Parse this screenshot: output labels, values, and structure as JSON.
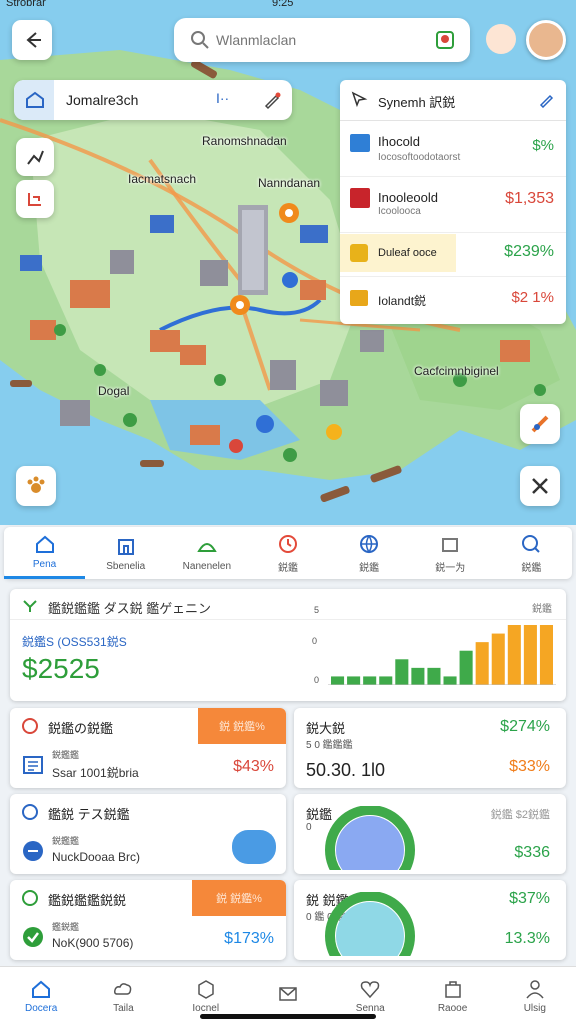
{
  "status": {
    "carrier": "Strobrar",
    "time": "9:25"
  },
  "search": {
    "placeholder": "Wlanmlaclan"
  },
  "location_card": {
    "title": "Jomalre3ch"
  },
  "map_labels": {
    "label1": "Ranomshnadan",
    "label2": "Iacmatsnach",
    "label3": "Nanndanan",
    "label4": "Cacfcimnbiginel",
    "label5": "Dogal"
  },
  "synch_panel": {
    "title": "Synemh 訳鋭",
    "items": [
      {
        "name": "Ihocold",
        "sub": "Iocosoftoodotaorst",
        "value": "$%",
        "color": "#2ba34a"
      },
      {
        "name": "Inooleoold",
        "sub": "Icoolooca",
        "value": "$1,353",
        "color": "#d9473a"
      },
      {
        "name": "Duleaf ooce",
        "sub": "",
        "value": "$239%",
        "color": "#2ba34a"
      },
      {
        "name": "Iolandt鋭",
        "sub": "",
        "value": "$2 1%",
        "color": "#d9473a"
      }
    ]
  },
  "tabs": [
    {
      "label": "Pena",
      "icon": "home-icon",
      "active": true
    },
    {
      "label": "Sbenelia",
      "icon": "building-icon",
      "active": false
    },
    {
      "label": "Nanenelen",
      "icon": "dome-icon",
      "active": false
    },
    {
      "label": "鋭鑑",
      "icon": "clock-icon",
      "active": false
    },
    {
      "label": "鋭鑑",
      "icon": "globe-icon",
      "active": false
    },
    {
      "label": "鋭一为",
      "icon": "box-icon",
      "active": false
    },
    {
      "label": "鋭鑑",
      "icon": "search-icon",
      "active": false
    }
  ],
  "stats_panel": {
    "title": "鑑鋭鑑鑑 ダス鋭 鑑ゲェニン",
    "right_label": "鋭鑑",
    "subtitle": "鋭鑑S (OSS531鋭S",
    "value": "$2525",
    "axis_top": "5",
    "axis_mid": "0",
    "axis_bottom": "0"
  },
  "chart_data": {
    "type": "bar",
    "values": [
      1,
      1,
      1,
      1,
      3,
      2,
      2,
      1,
      4,
      5,
      6,
      7,
      7,
      7
    ],
    "colors": [
      "#3faa4a",
      "#3faa4a",
      "#3faa4a",
      "#3faa4a",
      "#3faa4a",
      "#3faa4a",
      "#3faa4a",
      "#3faa4a",
      "#3faa4a",
      "#f5a623",
      "#f5a623",
      "#f5a623",
      "#f5a623",
      "#f5a623"
    ]
  },
  "left_cards": [
    {
      "title": "鋭鑑の鋭鑑",
      "badge": "鋭 鋭鑑%",
      "sub": "鋭鑑鑑",
      "detail": "Ssar 1001鋭bria",
      "value": "$43%",
      "value_color": "#d9473a",
      "icon": "list-icon"
    },
    {
      "title": "鑑鋭 テス鋭鑑",
      "badge": "",
      "sub": "鋭鑑鑑",
      "detail": "NuckDooaa Brc)",
      "value": "",
      "value_color": "#1e6fd9",
      "icon": "chat-icon"
    },
    {
      "title": "鑑鋭鑑鑑鋭鋭",
      "badge": "鋭 鋭鑑%",
      "sub": "鑑鋭鑑",
      "detail": "NoK(900 5706)",
      "value": "$173%",
      "value_color": "#1e88e5",
      "icon": "check-icon"
    }
  ],
  "right_cards": [
    {
      "title": "鋭大鋭",
      "sub": "5 0 鑑鑑鑑",
      "main": "50.30. 1l0",
      "value_top": "$274%",
      "value_bottom": "$33%",
      "top_color": "#2ba34a",
      "bottom_color": "#f07d1a"
    },
    {
      "title": "鋭鑑",
      "sub": "0",
      "main": "",
      "value_top": "鋭鑑 $2鋭鑑",
      "value_bottom": "$336",
      "top_color": "#999999",
      "bottom_color": "#2ba34a"
    },
    {
      "title": "鋭 鋭鑑",
      "sub": "0 鑑 0 鑑",
      "main": "",
      "value_top": "$37%",
      "value_bottom": "13.3%",
      "top_color": "#2ba34a",
      "bottom_color": "#2ba34a"
    }
  ],
  "nav": [
    {
      "label": "Docera",
      "icon": "home-icon",
      "active": true
    },
    {
      "label": "Taila",
      "icon": "cloud-icon",
      "active": false
    },
    {
      "label": "Iocnel",
      "icon": "cube-icon",
      "active": false
    },
    {
      "label": "",
      "icon": "mail-icon",
      "active": false
    },
    {
      "label": "Senna",
      "icon": "heart-icon",
      "active": false
    },
    {
      "label": "Raooe",
      "icon": "bag-icon",
      "active": false
    },
    {
      "label": "Ulsig",
      "icon": "user-icon",
      "active": false
    }
  ]
}
